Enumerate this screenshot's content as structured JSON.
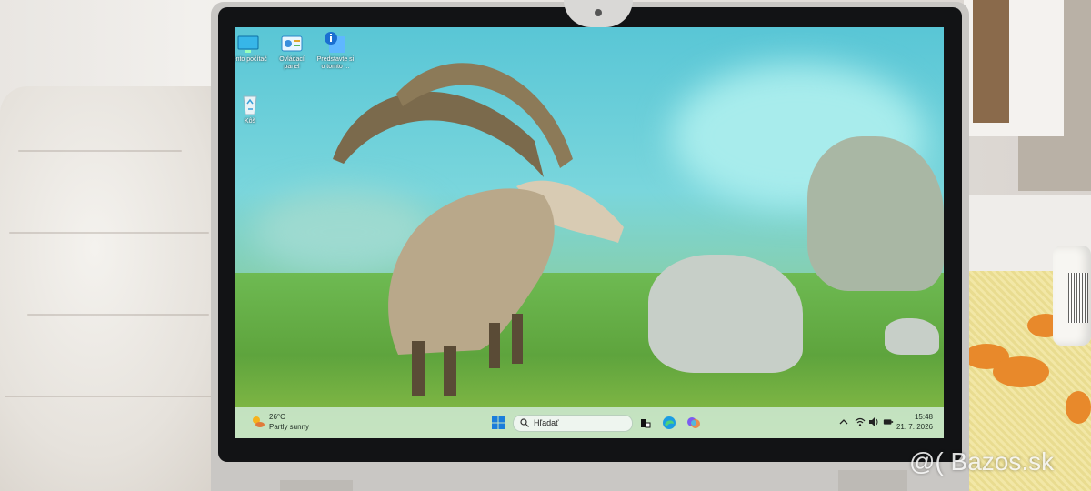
{
  "desktop": {
    "icons": [
      {
        "label_lines": [
          "Tento počítač"
        ],
        "icon": "monitor-icon"
      },
      {
        "label_lines": [
          "Ovládací",
          "panel"
        ],
        "icon": "control-panel-icon"
      },
      {
        "label_lines": [
          "Predstavte si",
          "o tomto ..."
        ],
        "icon": "info-icon"
      },
      {
        "label_lines": [
          "Kôš"
        ],
        "icon": "recycle-bin-icon"
      }
    ]
  },
  "taskbar": {
    "weather": {
      "temp": "26°C",
      "desc": "Partly sunny",
      "icon": "sun-cloud-icon"
    },
    "search_placeholder": "Hľadať",
    "apps": [
      "windows-start-icon",
      "task-view-icon",
      "edge-icon",
      "copilot-icon"
    ],
    "tray": [
      "chevron-up-icon",
      "wifi-icon",
      "volume-icon",
      "battery-icon"
    ],
    "clock": {
      "time": "15:48",
      "date": "21. 7. 2026"
    }
  },
  "watermark": "@( Bazos.sk",
  "colors": {
    "taskbar_bg": "#cde8d2",
    "sky": "#59c6d6",
    "grass": "#5fae4c",
    "bezel": "#121315"
  }
}
